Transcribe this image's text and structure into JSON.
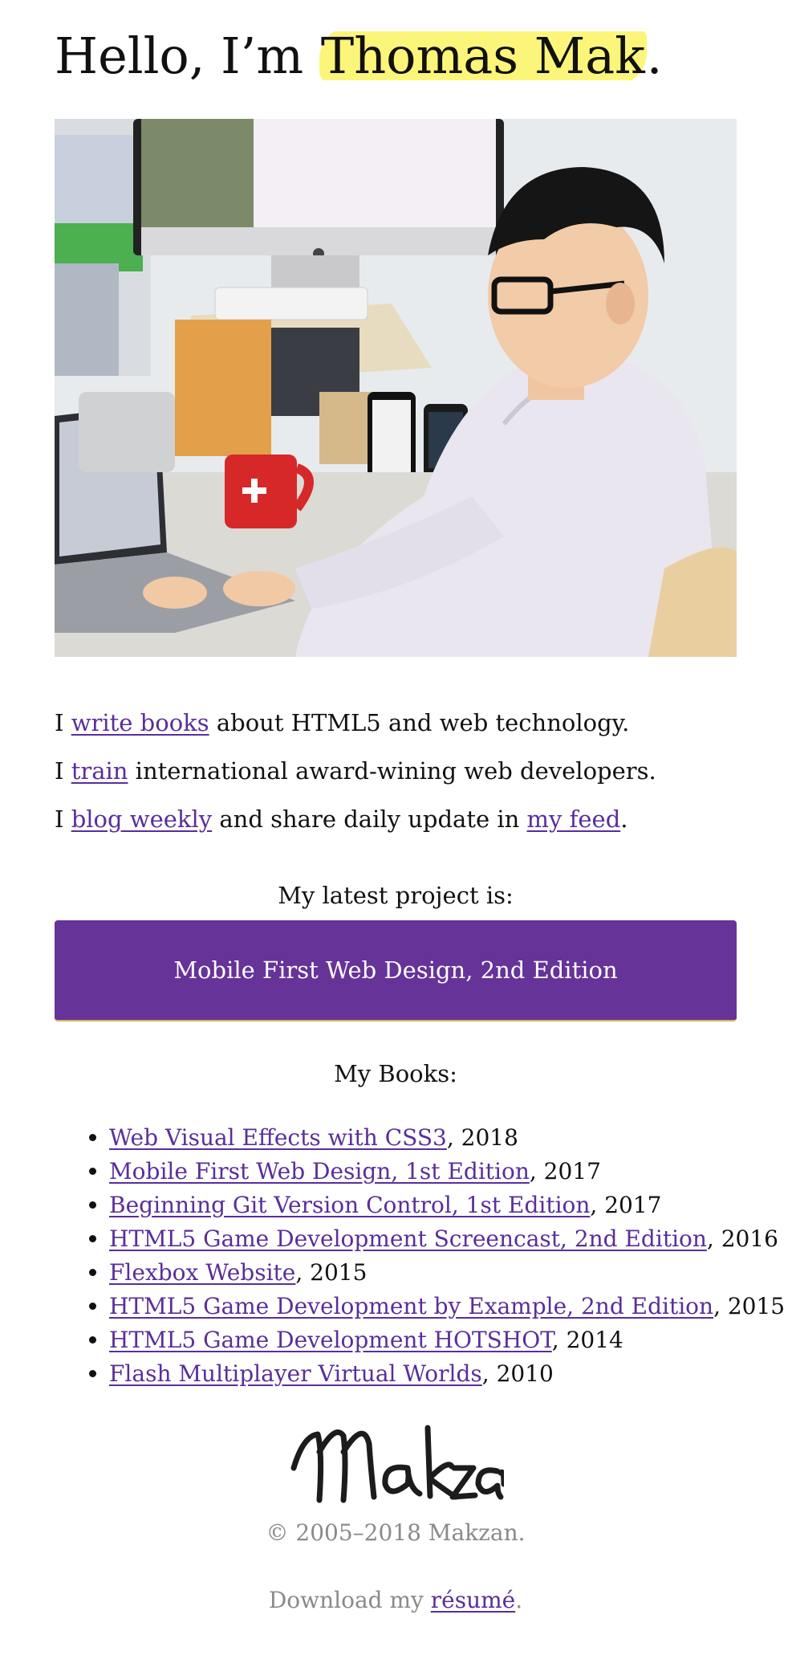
{
  "header": {
    "greeting": "Hello, I’m ",
    "name": "Thomas Mak",
    "punct": "."
  },
  "intro": {
    "line1": {
      "pre": "I ",
      "link": "write books",
      "post": " about HTML5 and web technology."
    },
    "line2": {
      "pre": "I ",
      "link": "train",
      "post": " international award-wining web developers."
    },
    "line3": {
      "pre": "I ",
      "link": "blog weekly",
      "mid": " and share daily update in ",
      "link2": "my feed",
      "post": "."
    }
  },
  "latest": {
    "label": "My latest project is:",
    "button": "Mobile First Web Design, 2nd Edition"
  },
  "books": {
    "title": "My Books:",
    "items": [
      {
        "title": "Web Visual Effects with CSS3",
        "year": ", 2018"
      },
      {
        "title": "Mobile First Web Design, 1st Edition",
        "year": ", 2017"
      },
      {
        "title": "Beginning Git Version Control, 1st Edition",
        "year": ", 2017"
      },
      {
        "title": "HTML5 Game Development Screencast, 2nd Edition",
        "year": ", 2016"
      },
      {
        "title": "Flexbox Website",
        "year": ", 2015"
      },
      {
        "title": "HTML5 Game Development by Example, 2nd Edition",
        "year": ", 2015"
      },
      {
        "title": "HTML5 Game Development HOTSHOT",
        "year": ", 2014"
      },
      {
        "title": "Flash Multiplayer Virtual Worlds",
        "year": ", 2010"
      }
    ]
  },
  "footer": {
    "signature": "Makzan",
    "copyright": "© 2005–2018 Makzan.",
    "download_pre": "Download my ",
    "download_link": "résumé",
    "download_post": "."
  },
  "colors": {
    "accent": "#663399",
    "link": "#5a2e9a",
    "highlight": "#fbf67a",
    "muted": "#8a8a8a"
  },
  "icons": {
    "signature": "makzan-signature-logo"
  }
}
